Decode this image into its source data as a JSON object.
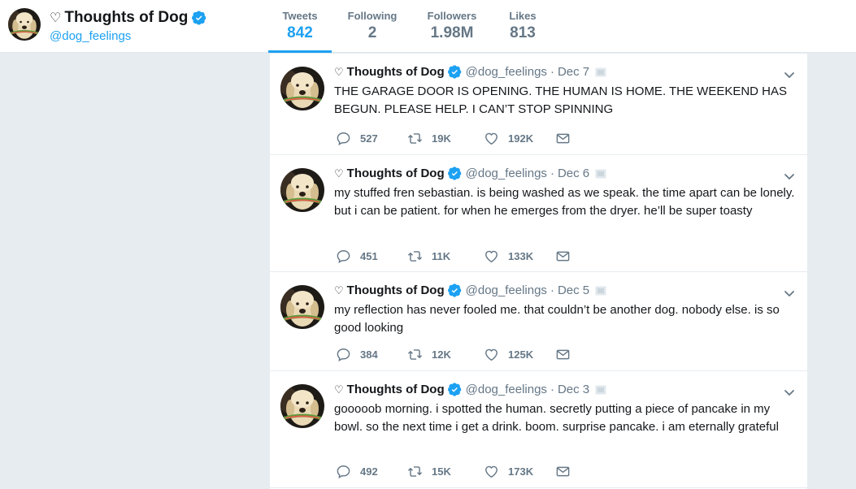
{
  "profile": {
    "heart": "♡",
    "name": "Thoughts of Dog",
    "handle": "@dog_feelings"
  },
  "stats": [
    {
      "label": "Tweets",
      "value": "842",
      "active": true
    },
    {
      "label": "Following",
      "value": "2",
      "active": false
    },
    {
      "label": "Followers",
      "value": "1.98M",
      "active": false
    },
    {
      "label": "Likes",
      "value": "813",
      "active": false
    }
  ],
  "tweets": [
    {
      "heart": "♡",
      "name": "Thoughts of Dog",
      "handle": "@dog_feelings",
      "sep": "·",
      "date": "Dec 7",
      "text": "THE GARAGE DOOR IS OPENING. THE HUMAN IS HOME. THE WEEKEND HAS BEGUN. PLEASE HELP. I CAN’T STOP SPINNING",
      "replies": "527",
      "retweets": "19K",
      "likes": "192K"
    },
    {
      "heart": "♡",
      "name": "Thoughts of Dog",
      "handle": "@dog_feelings",
      "sep": "·",
      "date": "Dec 6",
      "text": "my stuffed fren sebastian. is being washed as we speak. the time apart can be lonely. but i can be patient. for when he emerges from the dryer. he’ll be super toasty",
      "replies": "451",
      "retweets": "11K",
      "likes": "133K"
    },
    {
      "heart": "♡",
      "name": "Thoughts of Dog",
      "handle": "@dog_feelings",
      "sep": "·",
      "date": "Dec 5",
      "text": "my reflection has never fooled me. that couldn’t be another dog. nobody else. is so good looking",
      "replies": "384",
      "retweets": "12K",
      "likes": "125K"
    },
    {
      "heart": "♡",
      "name": "Thoughts of Dog",
      "handle": "@dog_feelings",
      "sep": "·",
      "date": "Dec 3",
      "text": "gooooob morning. i spotted the human. secretly putting a piece of pancake in my bowl. so the next time i get a drink. boom. surprise pancake. i am eternally grateful",
      "replies": "492",
      "retweets": "15K",
      "likes": "173K"
    }
  ],
  "colors": {
    "accent": "#1da1f2",
    "muted": "#657786",
    "background": "#e6ecf0"
  },
  "icons": [
    "verified-badge-icon",
    "dog-avatar",
    "caret-down-icon",
    "reply-icon",
    "retweet-icon",
    "like-icon",
    "direct-message-icon",
    "tweet-source-icon"
  ]
}
